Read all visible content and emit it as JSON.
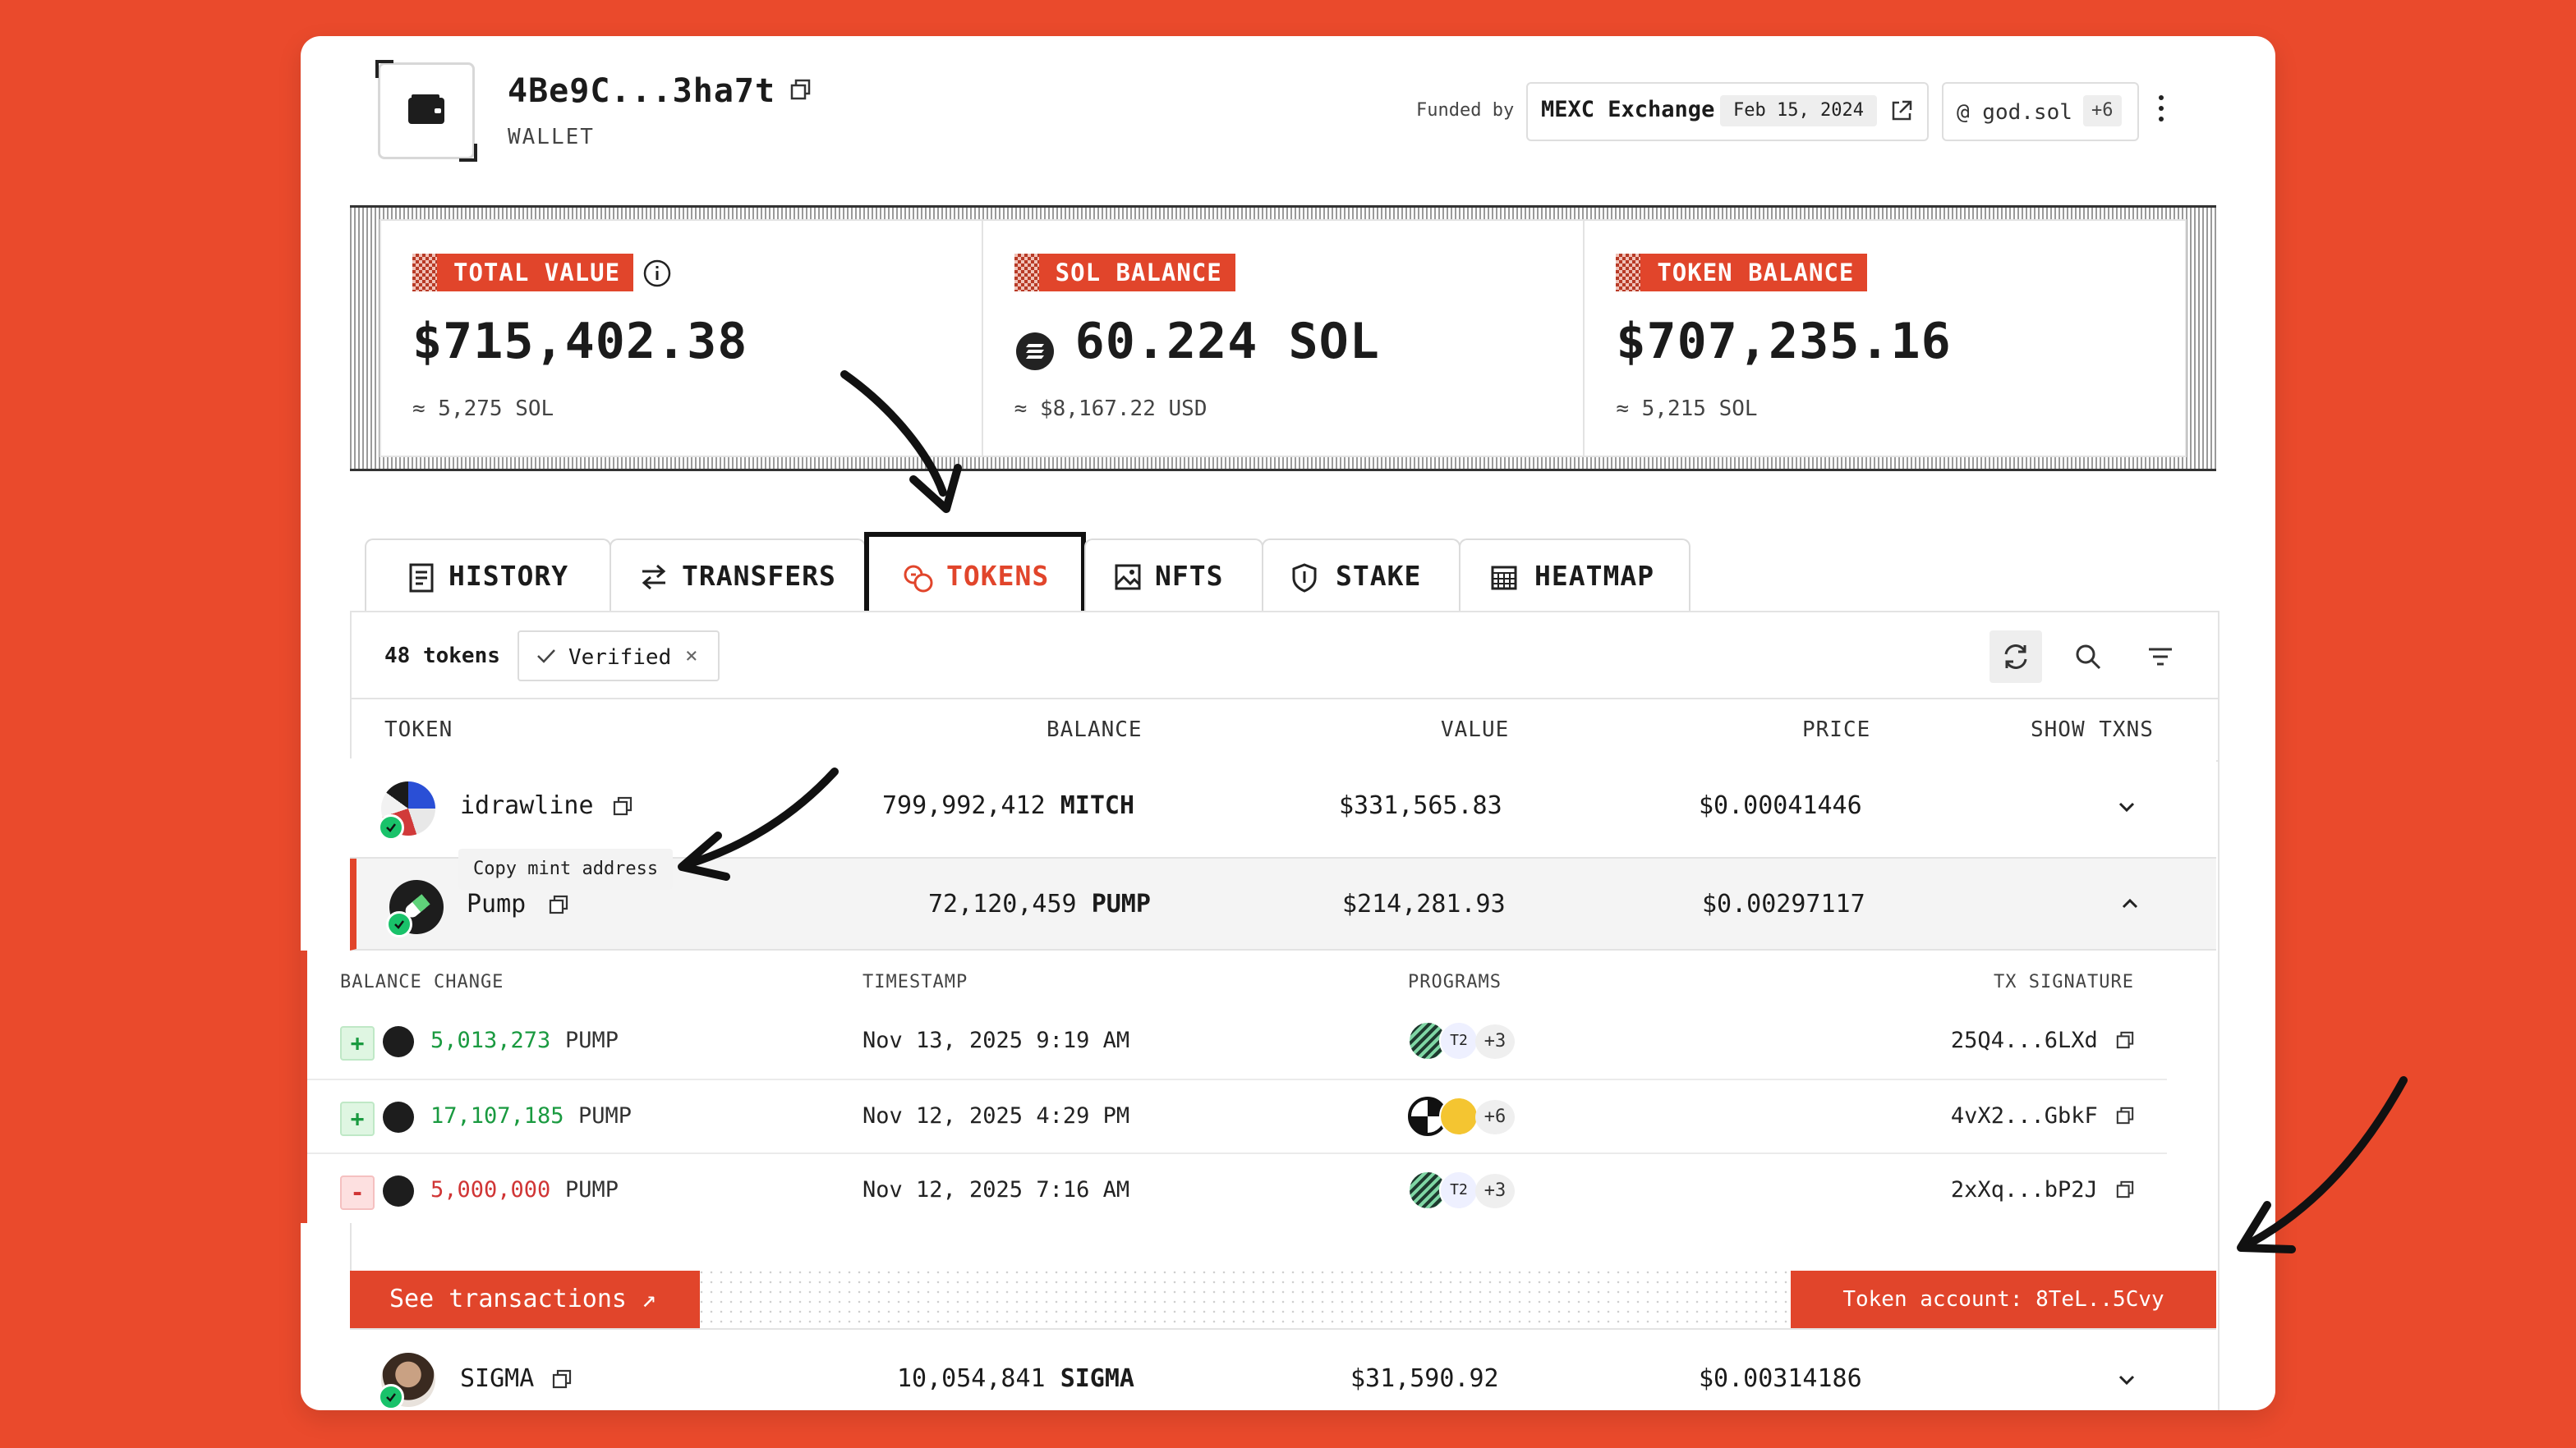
{
  "header": {
    "address": "4Be9C...3ha7t",
    "type_label": "WALLET",
    "funded_by_label": "Funded by",
    "funder": "MEXC Exchange",
    "funded_date": "Feb 15, 2024",
    "domain": "@ god.sol",
    "domain_more": "+6"
  },
  "summary": {
    "total": {
      "label": "TOTAL VALUE",
      "value": "$715,402.38",
      "sub": "≈ 5,275 SOL"
    },
    "sol": {
      "label": "SOL BALANCE",
      "value": "60.224 SOL",
      "sub": "≈ $8,167.22 USD"
    },
    "token": {
      "label": "TOKEN BALANCE",
      "value": "$707,235.16",
      "sub": "≈ 5,215 SOL"
    }
  },
  "tabs": [
    {
      "label": "HISTORY",
      "icon": "history-icon"
    },
    {
      "label": "TRANSFERS",
      "icon": "transfers-icon"
    },
    {
      "label": "TOKENS",
      "icon": "tokens-icon",
      "active": true
    },
    {
      "label": "NFTS",
      "icon": "nfts-icon"
    },
    {
      "label": "STAKE",
      "icon": "stake-icon"
    },
    {
      "label": "HEATMAP",
      "icon": "heatmap-icon"
    }
  ],
  "toolbar": {
    "count": "48 tokens",
    "filter_chip": "Verified",
    "filter_close": "×"
  },
  "columns": {
    "token": "TOKEN",
    "balance": "BALANCE",
    "value": "VALUE",
    "price": "PRICE",
    "show_txns": "SHOW TXNS"
  },
  "rows": [
    {
      "name": "idrawline",
      "balance": "799,992,412",
      "unit": "MITCH",
      "value": "$331,565.83",
      "price": "$0.00041446"
    },
    {
      "name": "Pump",
      "balance": "72,120,459",
      "unit": "PUMP",
      "value": "$214,281.93",
      "price": "$0.00297117"
    },
    {
      "name": "SIGMA",
      "balance": "10,054,841",
      "unit": "SIGMA",
      "value": "$31,590.92",
      "price": "$0.00314186"
    }
  ],
  "tooltip": "Copy mint address",
  "expanded": {
    "headers": {
      "change": "BALANCE CHANGE",
      "timestamp": "TIMESTAMP",
      "programs": "PROGRAMS",
      "signature": "TX SIGNATURE"
    },
    "txns": [
      {
        "sign": "+",
        "amount": "5,013,273",
        "unit": "PUMP",
        "timestamp": "Nov 13, 2025 9:19 AM",
        "more": "+3",
        "prog_label": "T2",
        "sig": "25Q4...6LXd"
      },
      {
        "sign": "+",
        "amount": "17,107,185",
        "unit": "PUMP",
        "timestamp": "Nov 12, 2025 4:29 PM",
        "more": "+6",
        "prog_label": "",
        "sig": "4vX2...GbkF"
      },
      {
        "sign": "-",
        "amount": "5,000,000",
        "unit": "PUMP",
        "timestamp": "Nov 12, 2025 7:16 AM",
        "more": "+3",
        "prog_label": "T2",
        "sig": "2xXq...bP2J"
      }
    ],
    "see_transactions": "See transactions ↗",
    "token_account": "Token account: 8TeL..5Cvy"
  },
  "colors": {
    "accent": "#e1452b",
    "background": "#ea4a2c",
    "positive": "#1a9a40",
    "negative": "#d03535"
  }
}
